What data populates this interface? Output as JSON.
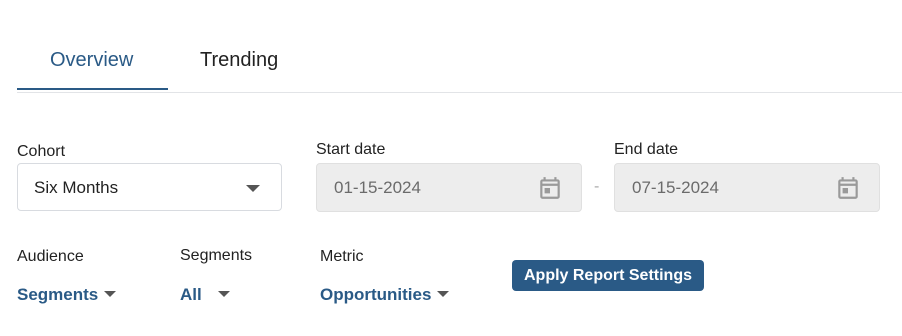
{
  "tabs": [
    {
      "label": "Overview",
      "active": true
    },
    {
      "label": "Trending",
      "active": false
    }
  ],
  "cohort": {
    "label": "Cohort",
    "value": "Six Months"
  },
  "start_date": {
    "label": "Start date",
    "value": "01-15-2024",
    "icon": "calendar-icon"
  },
  "separator": "-",
  "end_date": {
    "label": "End date",
    "value": "07-15-2024",
    "icon": "calendar-icon"
  },
  "audience": {
    "label": "Audience",
    "value": "Segments"
  },
  "segments": {
    "label": "Segments",
    "value": "All"
  },
  "metric": {
    "label": "Metric",
    "value": "Opportunities"
  },
  "apply_button": {
    "label": "Apply Report Settings"
  },
  "colors": {
    "accent": "#2a5a86",
    "disabled_bg": "#ededed",
    "border": "#d8dbe0"
  }
}
